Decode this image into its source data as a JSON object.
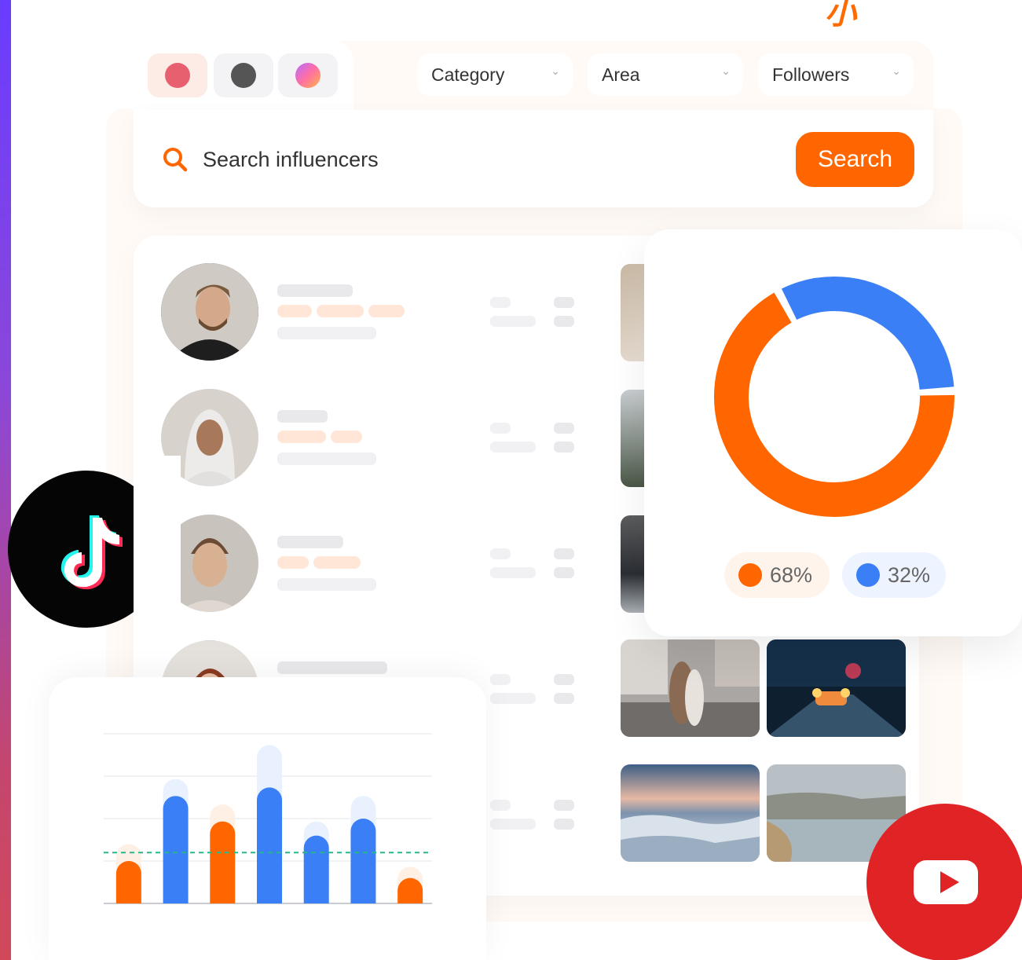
{
  "brand": {
    "mark": "小"
  },
  "colors": {
    "accent": "#ff6600",
    "blue": "#3b7ff6",
    "tiktok_bg": "#050505",
    "youtube_red": "#e02426"
  },
  "social_tabs": [
    {
      "name": "youtube",
      "color": "#e66070"
    },
    {
      "name": "tiktok",
      "color": "#5a5a5a"
    },
    {
      "name": "instagram",
      "color": "gradient"
    }
  ],
  "filters": {
    "category": "Category",
    "area": "Area",
    "followers": "Followers"
  },
  "search": {
    "placeholder": "Search influencers",
    "button_label": "Search"
  },
  "influencers": [
    {
      "avatar": "man-bearded"
    },
    {
      "avatar": "woman-hijab"
    },
    {
      "avatar": "woman-bun"
    },
    {
      "avatar": "woman-redhead"
    }
  ],
  "chart_data": [
    {
      "type": "pie",
      "variant": "donut",
      "series": [
        {
          "label": "68%",
          "value": 68,
          "color": "#ff6600",
          "icon": "female-icon"
        },
        {
          "label": "32%",
          "value": 32,
          "color": "#3b7ff6",
          "icon": "male-icon"
        }
      ]
    },
    {
      "type": "bar",
      "grid": true,
      "bars": [
        {
          "value": 1.5,
          "ghost": 2.1,
          "color": "#ff6600"
        },
        {
          "value": 3.8,
          "ghost": 4.4,
          "color": "#3b7ff6"
        },
        {
          "value": 2.9,
          "ghost": 3.5,
          "color": "#ff6600"
        },
        {
          "value": 4.1,
          "ghost": 5.6,
          "color": "#3b7ff6"
        },
        {
          "value": 2.4,
          "ghost": 2.9,
          "color": "#3b7ff6"
        },
        {
          "value": 3.0,
          "ghost": 3.8,
          "color": "#3b7ff6"
        },
        {
          "value": 0.9,
          "ghost": 1.3,
          "color": "#ff6600"
        }
      ],
      "reference_line": 1.8,
      "ylim": [
        0,
        6
      ]
    }
  ]
}
